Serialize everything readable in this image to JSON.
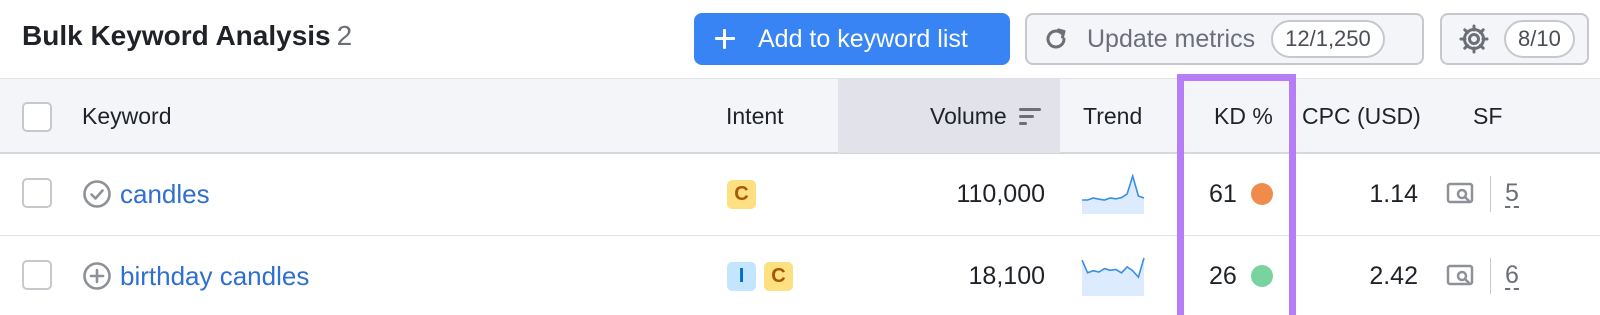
{
  "header": {
    "title": "Bulk Keyword Analysis",
    "count": "2",
    "add_button_label": "Add to keyword list",
    "update_button_label": "Update metrics",
    "update_quota": "12/1,250",
    "settings_quota": "8/10"
  },
  "table": {
    "columns": {
      "keyword": "Keyword",
      "intent": "Intent",
      "volume": "Volume",
      "trend": "Trend",
      "kd": "KD %",
      "cpc": "CPC (USD)",
      "sf": "SF"
    },
    "sorted_column": "Volume",
    "rows": [
      {
        "keyword": "candles",
        "status_icon": "check-circle-icon",
        "intents": [
          "C"
        ],
        "volume": "110,000",
        "trend": [
          3,
          3,
          3.5,
          3.2,
          3,
          3.5,
          3.3,
          3.6,
          4.5,
          9,
          4,
          3.5
        ],
        "kd": "61",
        "kd_color": "#f08c4b",
        "cpc": "1.14",
        "sf": "5"
      },
      {
        "keyword": "birthday candles",
        "status_icon": "plus-circle-icon",
        "intents": [
          "I",
          "C"
        ],
        "volume": "18,100",
        "trend": [
          8,
          5,
          5.5,
          5.2,
          6,
          5.6,
          5.8,
          5,
          6.4,
          5.5,
          4,
          8.5
        ],
        "kd": "26",
        "kd_color": "#79d39e",
        "cpc": "2.42",
        "sf": "6"
      }
    ]
  },
  "colors": {
    "primary": "#3884f4",
    "link": "#2f6fd1",
    "highlight": "#b57ef6"
  }
}
